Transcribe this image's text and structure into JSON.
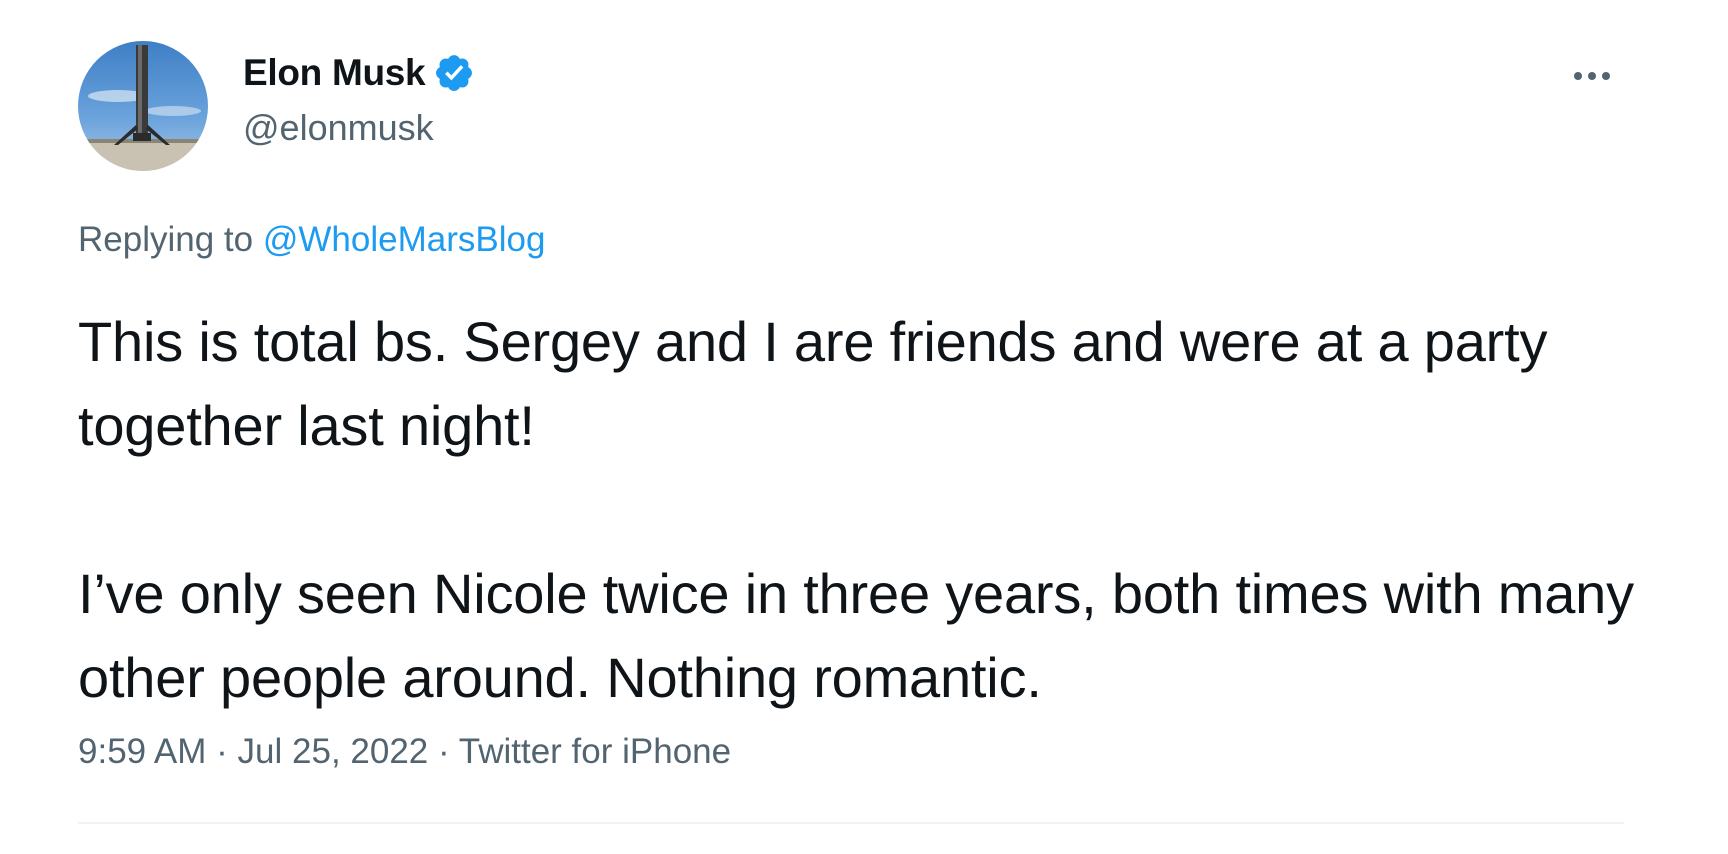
{
  "author": {
    "display_name": "Elon Musk",
    "handle": "@elonmusk",
    "verified": true,
    "avatar_icon": "rocket-booster-avatar"
  },
  "reply": {
    "prefix": "Replying to",
    "target": "@WholeMarsBlog"
  },
  "body": {
    "paragraph_1": "This is total bs. Sergey and I are friends and were at a party together last night!",
    "paragraph_2": "I’ve only seen Nicole twice in three years, both times with many other people around. Nothing romantic."
  },
  "meta": {
    "time": "9:59 AM",
    "date": "Jul 25, 2022",
    "source": "Twitter for iPhone",
    "separator": "·"
  },
  "colors": {
    "text": "#0f1419",
    "muted": "#536471",
    "accent": "#1d9bf0",
    "divider": "#eff3f4"
  },
  "icons": {
    "verified": "verified-badge-icon",
    "more": "more-options-icon"
  }
}
